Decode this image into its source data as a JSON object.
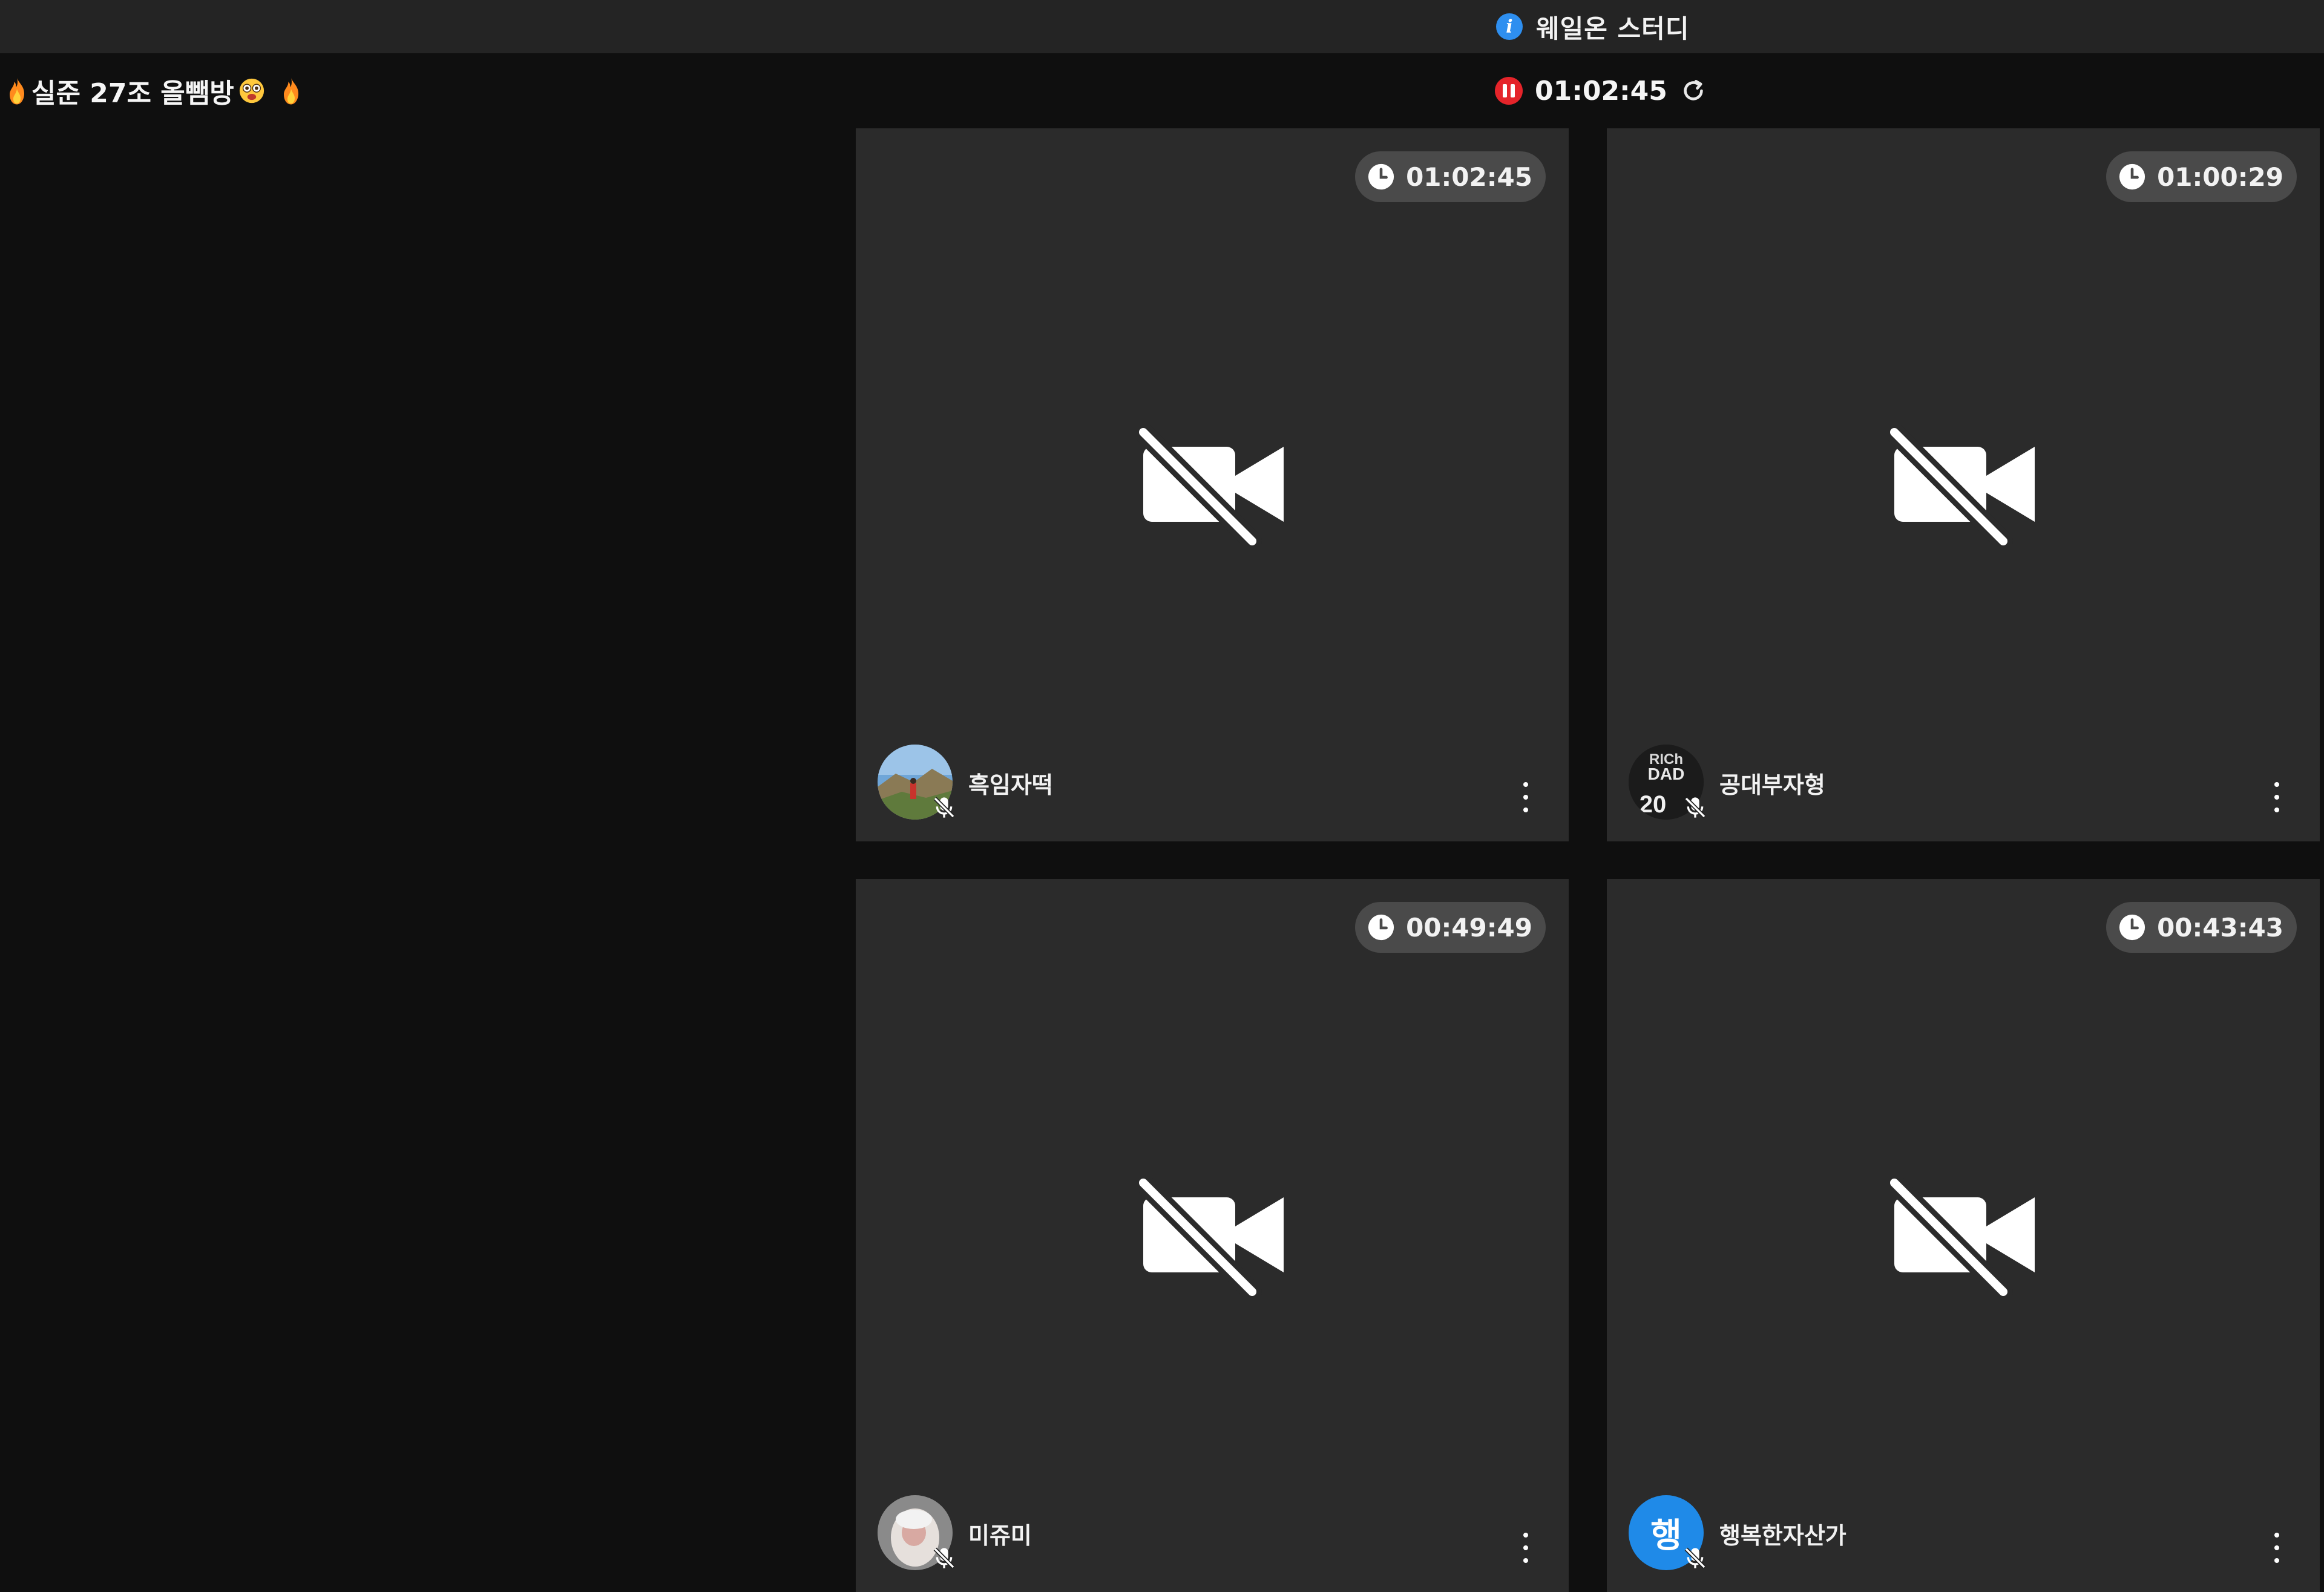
{
  "window": {
    "app_title": "웨일온 스터디",
    "info_icon": "info-icon",
    "info_icon_glyph": "i"
  },
  "header": {
    "room_title": "실준 27조 올뺌방",
    "main_timer": "01:02:45",
    "status_color": "#e5242a"
  },
  "participants": [
    {
      "name": "흑임자떡",
      "time": "01:02:45",
      "avatar": "landscape-photo",
      "mic": "muted",
      "camera": "off"
    },
    {
      "name": "공대부자형",
      "time": "01:00:29",
      "avatar": "book-cover-photo",
      "avatar_text": [
        "RICh",
        "DAD",
        "20"
      ],
      "mic": "muted",
      "camera": "off"
    },
    {
      "name": "미쥬미",
      "time": "00:49:49",
      "avatar": "portrait-photo",
      "mic": "muted",
      "camera": "off"
    },
    {
      "name": "행복한자산가",
      "time": "00:43:43",
      "avatar_letter": "행",
      "avatar_color": "#1f8ae8",
      "mic": "muted",
      "camera": "off"
    }
  ],
  "colors": {
    "background": "#0f0f0f",
    "titlebar": "#242424",
    "tile": "#2b2b2b",
    "time_pill": "#4a4a4a",
    "accent_blue": "#2e8ff0"
  }
}
